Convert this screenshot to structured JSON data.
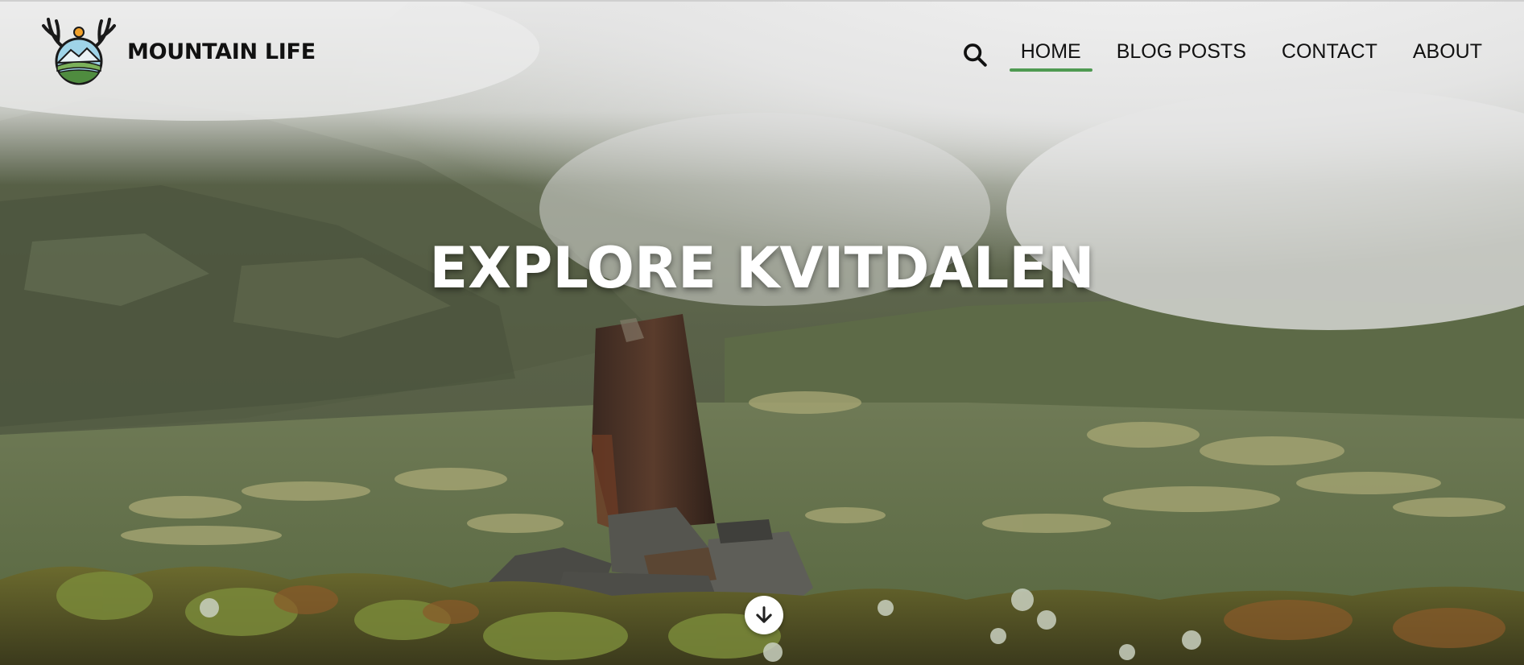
{
  "header": {
    "brand_name": "MOUNTAIN LIFE",
    "logo_icon": "mountain-antler-logo",
    "nav": [
      {
        "label": "HOME",
        "active": true
      },
      {
        "label": "BLOG POSTS",
        "active": false
      },
      {
        "label": "CONTACT",
        "active": false
      },
      {
        "label": "ABOUT",
        "active": false
      }
    ],
    "search_icon": "search-icon"
  },
  "hero": {
    "title": "EXPLORE KVITDALEN",
    "scroll_icon": "arrow-down-icon"
  },
  "colors": {
    "accent": "#4f9a52",
    "nav_text": "#111111",
    "title_text": "#ffffff"
  }
}
